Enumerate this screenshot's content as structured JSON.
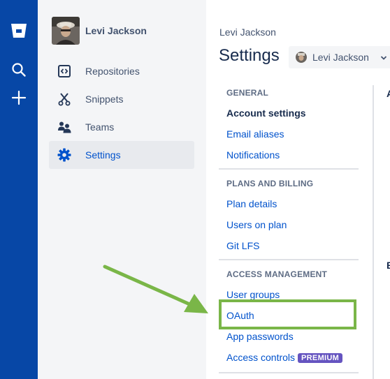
{
  "user": {
    "name": "Levi Jackson"
  },
  "sidebar": {
    "items": [
      {
        "label": "Repositories",
        "icon": "repositories-icon"
      },
      {
        "label": "Snippets",
        "icon": "snippets-icon"
      },
      {
        "label": "Teams",
        "icon": "teams-icon"
      },
      {
        "label": "Settings",
        "icon": "gear-icon",
        "active": true
      }
    ]
  },
  "header": {
    "breadcrumb": "Levi Jackson",
    "title": "Settings",
    "account_selector": "Levi Jackson"
  },
  "settings_nav": {
    "general": {
      "heading": "GENERAL",
      "items": [
        "Account settings",
        "Email aliases",
        "Notifications"
      ]
    },
    "plans": {
      "heading": "PLANS AND BILLING",
      "items": [
        "Plan details",
        "Users on plan",
        "Git LFS"
      ]
    },
    "access": {
      "heading": "ACCESS MANAGEMENT",
      "items": [
        "User groups",
        "OAuth",
        "App passwords",
        "Access controls"
      ],
      "premium_badge": "PREMIUM"
    }
  },
  "clipped_right_text": {
    "top": "A",
    "middle": "E"
  },
  "colors": {
    "global_nav": "#0747a6",
    "link": "#0052cc",
    "highlight": "#7ab648",
    "premium": "#6554c0"
  }
}
